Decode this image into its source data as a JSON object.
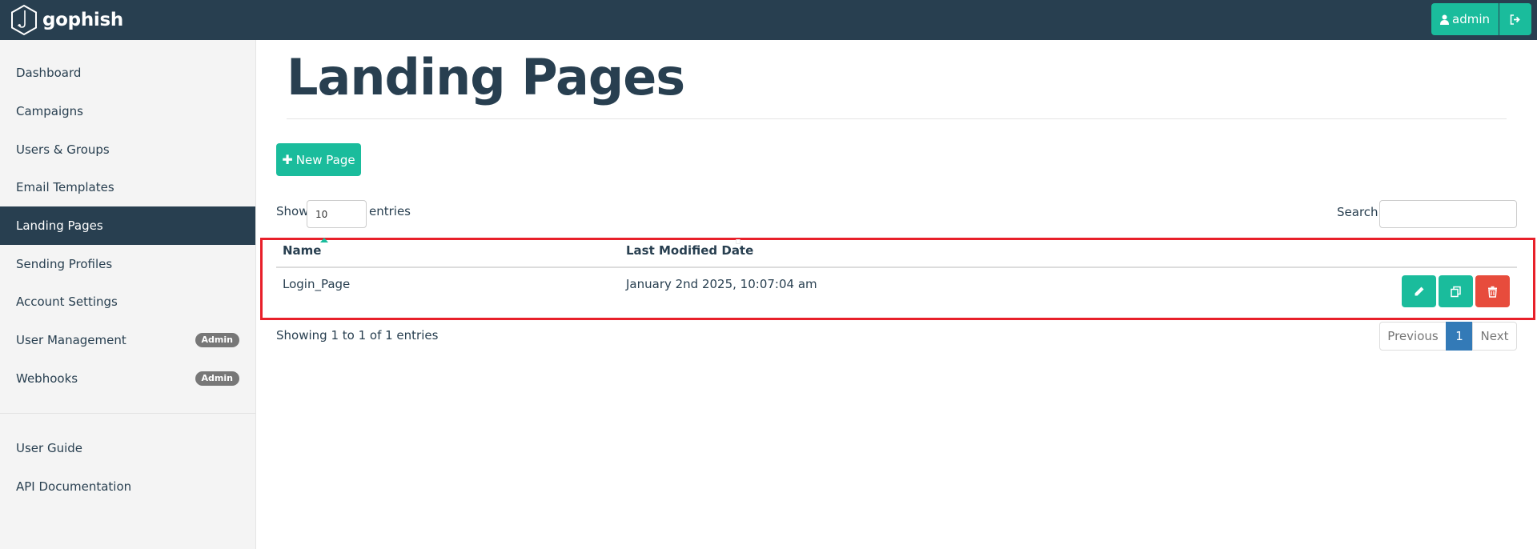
{
  "brand": {
    "name": "gophish"
  },
  "navbar": {
    "user_label": "admin"
  },
  "sidebar": {
    "items": [
      {
        "label": "Dashboard"
      },
      {
        "label": "Campaigns"
      },
      {
        "label": "Users & Groups"
      },
      {
        "label": "Email Templates"
      },
      {
        "label": "Landing Pages",
        "active": true
      },
      {
        "label": "Sending Profiles"
      },
      {
        "label": "Account Settings"
      },
      {
        "label": "User Management",
        "badge": "Admin"
      },
      {
        "label": "Webhooks",
        "badge": "Admin"
      }
    ],
    "help_items": [
      {
        "label": "User Guide"
      },
      {
        "label": "API Documentation"
      }
    ]
  },
  "page": {
    "title": "Landing Pages",
    "new_button_label": "New Page"
  },
  "table_controls": {
    "show_label": "Show",
    "page_size": "10",
    "entries_label": "entries",
    "search_label": "Search:",
    "search_value": ""
  },
  "table": {
    "columns": [
      "Name",
      "Last Modified Date"
    ],
    "sort_column": "Name",
    "sort_direction": "asc",
    "rows": [
      {
        "name": "Login_Page",
        "modified": "January 2nd 2025, 10:07:04 am"
      }
    ],
    "row_actions": [
      "pencil-icon",
      "copy-icon",
      "trash-icon"
    ]
  },
  "pagination": {
    "info": "Showing 1 to 1 of 1 entries",
    "previous": "Previous",
    "current": "1",
    "next": "Next"
  },
  "colors": {
    "navbar": "#283f50",
    "accent": "#1abc9c",
    "danger": "#e74c3c",
    "highlight": "#e8202a",
    "page_active": "#337ab7"
  }
}
